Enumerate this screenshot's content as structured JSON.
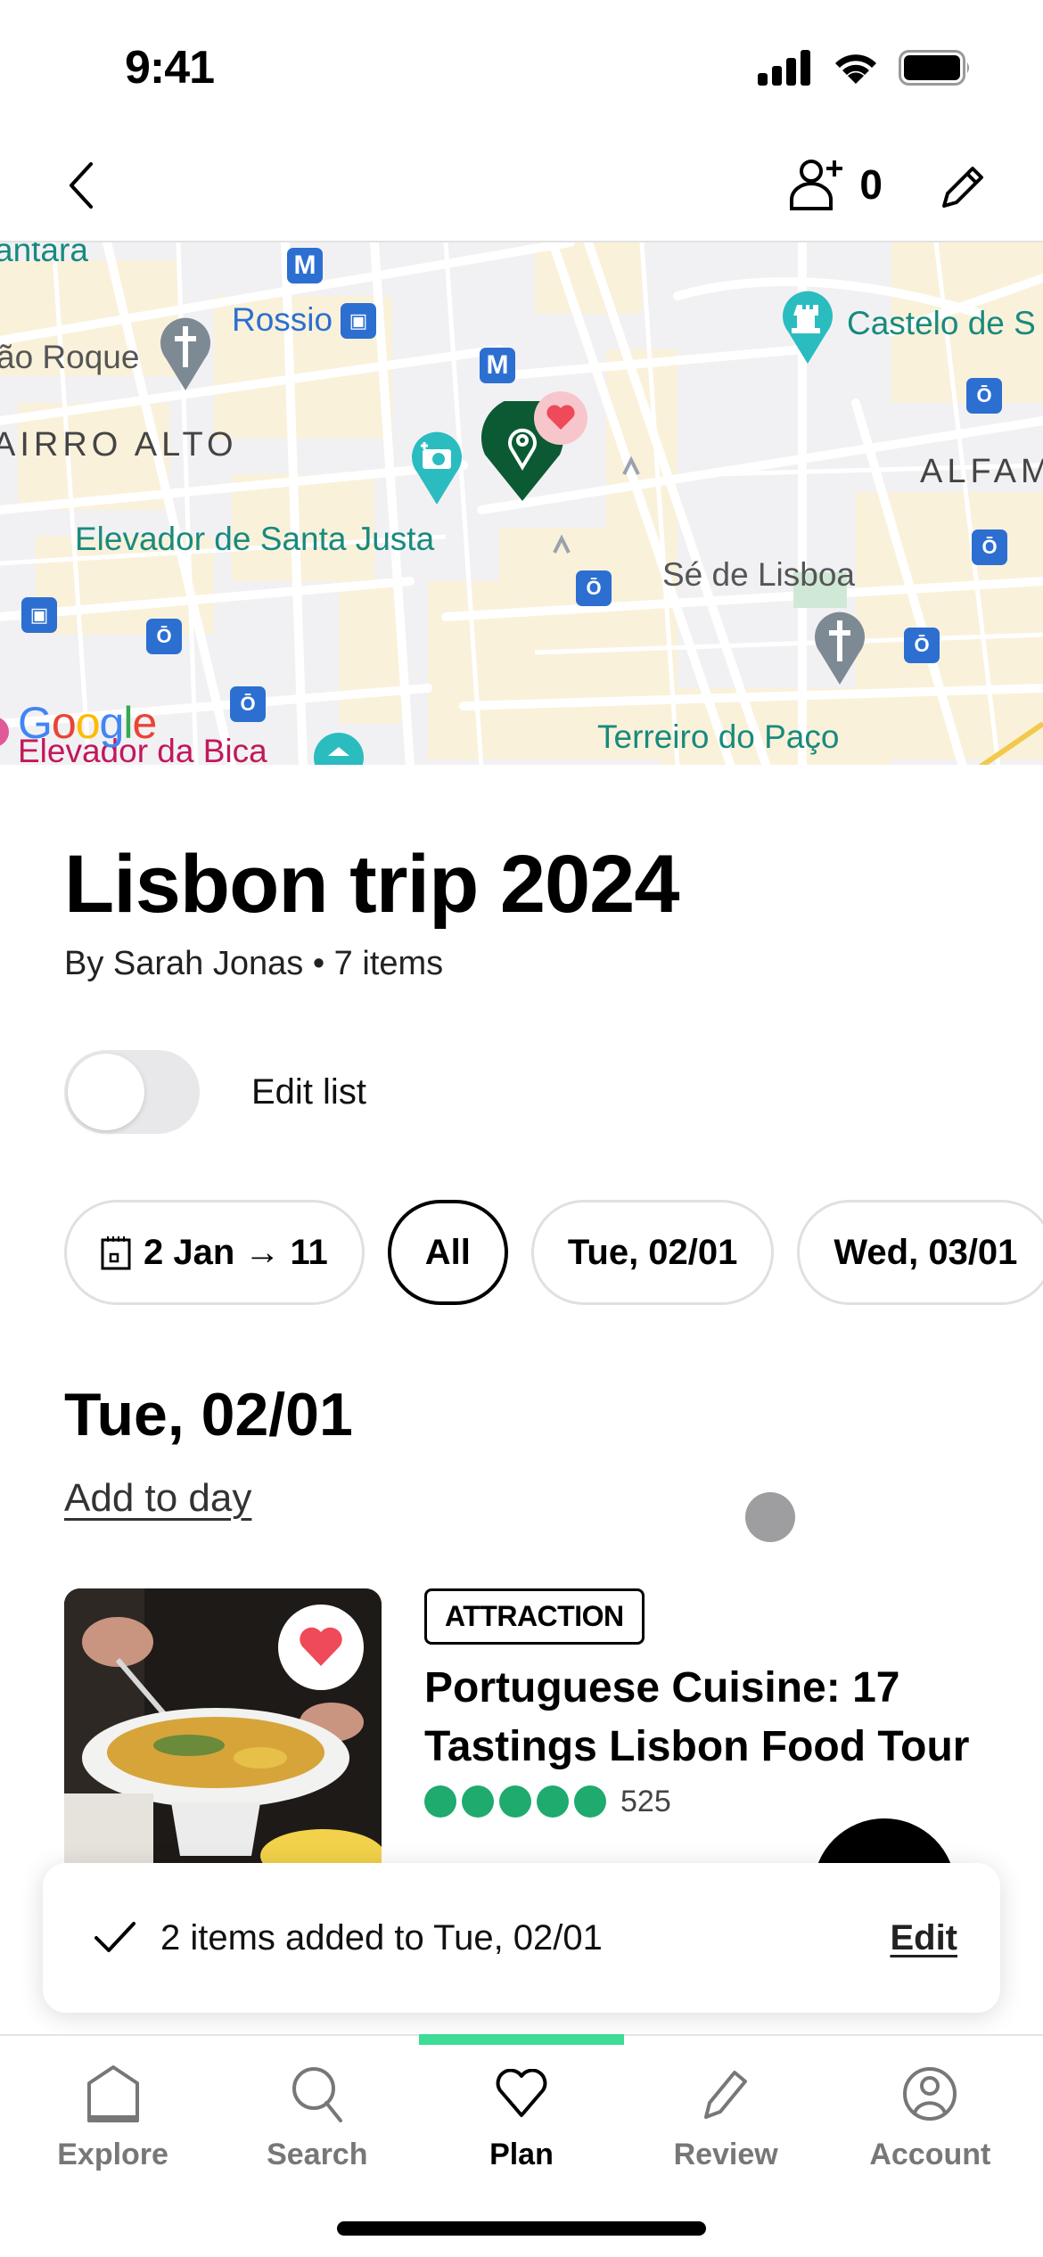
{
  "status_bar": {
    "time": "9:41"
  },
  "header": {
    "collaborators_count": "0"
  },
  "map": {
    "labels": {
      "top_left_partial": "antara",
      "sao_roque": "ão Roque",
      "rossio": "Rossio",
      "bairro_alto": "AIRRO ALTO",
      "santa_justa": "Elevador de Santa Justa",
      "castelo": "Castelo de S",
      "alfama": "ALFAM",
      "se_de_lisboa": "Sé de Lisboa",
      "terreiro": "Terreiro do Paço",
      "bica": "Elevador da Bica",
      "metro": "M"
    },
    "attribution": "Google",
    "colors": {
      "pin": "#0b5a33",
      "fav": "#ef4a5a",
      "teal_poi": "#2bbcc0",
      "transit": "#2c6fd1"
    }
  },
  "trip": {
    "title": "Lisbon trip 2024",
    "meta": "By Sarah Jonas • 7 items",
    "edit_toggle_label": "Edit list",
    "edit_toggle_on": false
  },
  "chips": [
    {
      "label": "2 Jan → 11",
      "icon": "calendar-icon",
      "active": false
    },
    {
      "label": "All",
      "active": true
    },
    {
      "label": "Tue, 02/01",
      "active": false
    },
    {
      "label": "Wed, 03/01",
      "active": false
    }
  ],
  "day": {
    "heading": "Tue, 02/01",
    "add_link": "Add to day"
  },
  "items": [
    {
      "category": "ATTRACTION",
      "title": "Portuguese Cuisine: 17 Tastings Lisbon Food Tour",
      "rating": 5,
      "review_count": "525",
      "favorited": true
    }
  ],
  "toast": {
    "message": "2 items added to Tue, 02/01",
    "action": "Edit"
  },
  "bottom_nav": {
    "items": [
      {
        "label": "Explore",
        "icon": "home-icon"
      },
      {
        "label": "Search",
        "icon": "search-icon"
      },
      {
        "label": "Plan",
        "icon": "heart-icon",
        "active": true
      },
      {
        "label": "Review",
        "icon": "pencil-icon"
      },
      {
        "label": "Account",
        "icon": "account-icon"
      }
    ],
    "accent": "#3ddc97"
  }
}
